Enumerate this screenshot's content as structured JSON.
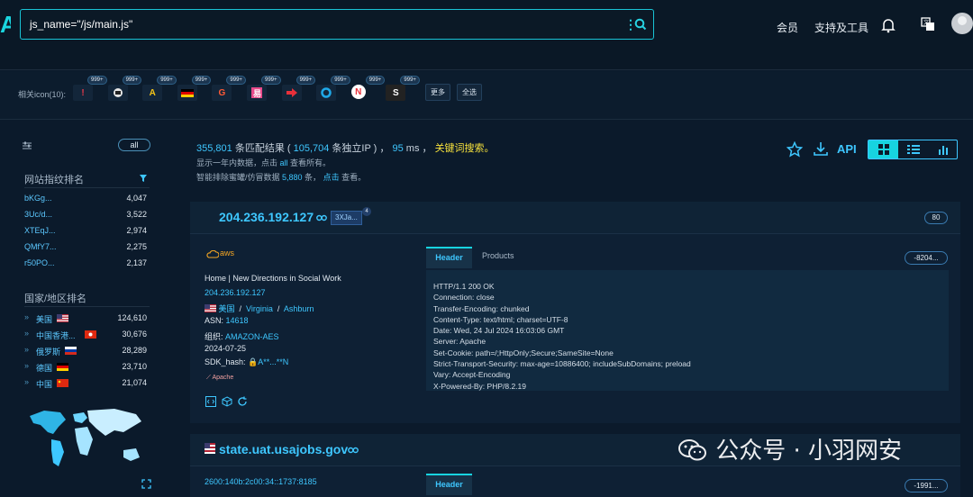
{
  "logo": "A",
  "search": {
    "query": "js_name=\"/js/main.js\""
  },
  "nav": {
    "member": "会员",
    "support": "支持及工具"
  },
  "icon_bar": {
    "label": "相关icon(10):",
    "badge": "999+",
    "more": "更多",
    "select_all": "全选",
    "icons": [
      "!",
      "",
      "A",
      "",
      "G",
      "",
      "",
      "",
      "N",
      "S"
    ]
  },
  "sidebar": {
    "all": "all",
    "site_title": "网站指纹排名",
    "sites": [
      {
        "k": "bKGg...",
        "v": "4,047"
      },
      {
        "k": "3Uc/d...",
        "v": "3,522"
      },
      {
        "k": "XTEqJ...",
        "v": "2,974"
      },
      {
        "k": "QMfY7...",
        "v": "2,275"
      },
      {
        "k": "r50PO...",
        "v": "2,137"
      }
    ],
    "country_title": "国家/地区排名",
    "countries": [
      {
        "k": "美国",
        "v": "124,610"
      },
      {
        "k": "中国香港...",
        "v": "30,676"
      },
      {
        "k": "俄罗斯",
        "v": "28,289"
      },
      {
        "k": "德国",
        "v": "23,710"
      },
      {
        "k": "中国",
        "v": "21,074"
      }
    ]
  },
  "summary": {
    "count": "355,801",
    "text1": " 条匹配结果 ( ",
    "ip_count": "105,704",
    "text2": " 条独立IP ) ， ",
    "ms": "95",
    "text3": " ms ，",
    "keyword": "关键词搜索。",
    "sub1_a": "显示一年内数据，点击 ",
    "sub1_all": "all",
    "sub1_b": " 查看所有。",
    "sub2_a": "智能排除蜜罐/仿冒数据 ",
    "sub2_num": "5,880",
    "sub2_b": " 条， ",
    "sub2_click": "点击",
    "sub2_c": " 查看。",
    "api": "API"
  },
  "result1": {
    "ip": "204.236.192.127",
    "tag": "3XJa...",
    "tag_count": "4",
    "port": "80",
    "cloud": "aws",
    "title": "Home | New Directions in Social Work",
    "ip_link": "204.236.192.127",
    "country": "美国",
    "region": "Virginia",
    "city": "Ashburn",
    "asn_label": "ASN: ",
    "asn": "14618",
    "org_label": "组织: ",
    "org": "AMAZON-AES",
    "date": "2024-07-25",
    "sdk_label": "SDK_hash: ",
    "sdk": "A**...**N",
    "server_tag": "Apache",
    "tab_header": "Header",
    "tab_products": "Products",
    "hash": "-8204...",
    "headers": [
      "HTTP/1.1 200 OK",
      "Connection: close",
      "Transfer-Encoding: chunked",
      "Content-Type: text/html; charset=UTF-8",
      "Date: Wed, 24 Jul 2024 16:03:06 GMT",
      "Server: Apache",
      "Set-Cookie: path=/;HttpOnly;Secure;SameSite=None",
      "Strict-Transport-Security: max-age=10886400; includeSubDomains; preload",
      "Vary: Accept-Encoding",
      "X-Powered-By: PHP/8.2.19"
    ]
  },
  "result2": {
    "domain": "state.uat.usajobs.gov",
    "ip_link": "2600:140b:2c00:34::1737:8185",
    "tab_header": "Header",
    "hash": "-1991..."
  },
  "watermark": "公众号 · 小羽网安",
  "colors": {
    "accent": "#17d4e0",
    "link": "#3ec7ff",
    "highlight": "#f7e23c",
    "bg": "#0b1a2b"
  }
}
